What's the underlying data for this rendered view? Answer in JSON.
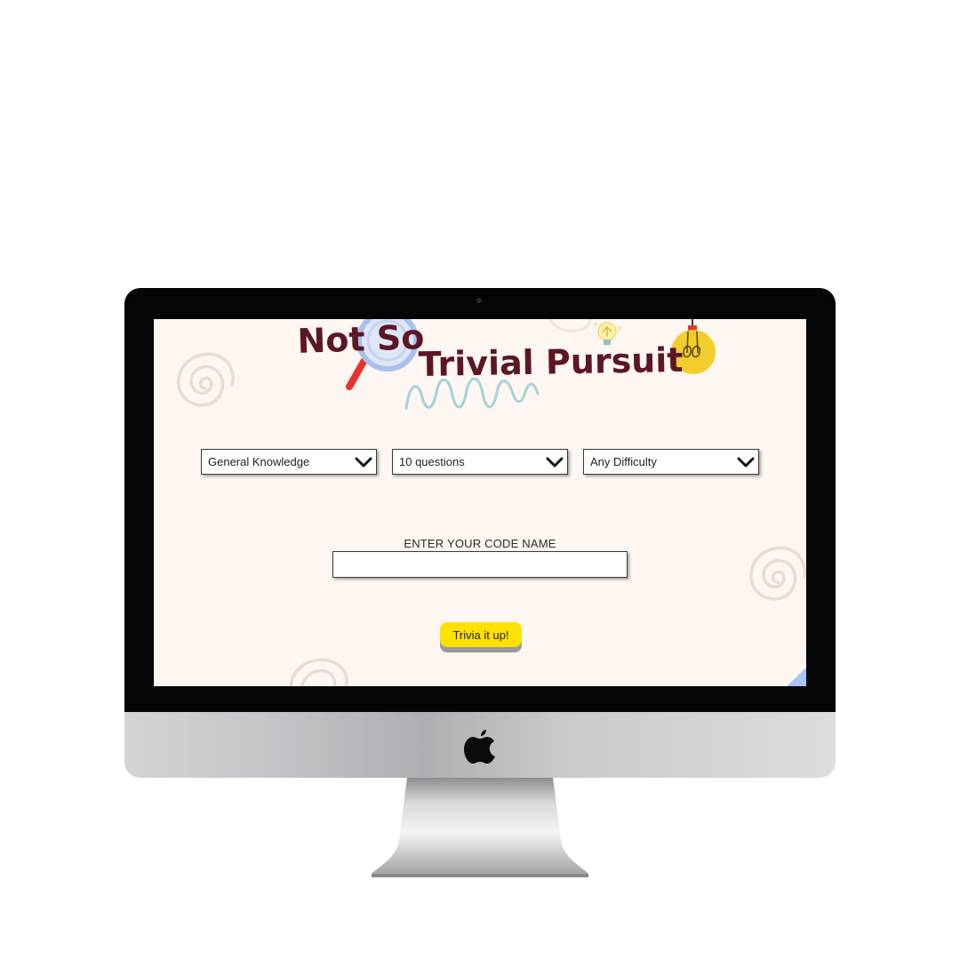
{
  "app": {
    "title_part1": "Not So",
    "title_part2": "Trivial Pursuit"
  },
  "filters": {
    "category": {
      "selected": "General Knowledge"
    },
    "amount": {
      "selected": "10 questions"
    },
    "difficulty": {
      "selected": "Any Difficulty"
    }
  },
  "codename": {
    "label": "ENTER YOUR CODE NAME",
    "value": "",
    "placeholder": ""
  },
  "start_button": {
    "label": "Trivia it up!"
  },
  "colors": {
    "title": "#5b1724",
    "button": "#ffe100",
    "screen_bg": "#fdf6f1",
    "accent_blue": "#a9c4f5",
    "accent_teal": "#a6d3d6"
  },
  "icons": [
    "magnifier-icon",
    "lightbulb-icon",
    "squiggle-icon",
    "swirl-icon",
    "chevron-down-icon",
    "apple-logo-icon"
  ]
}
